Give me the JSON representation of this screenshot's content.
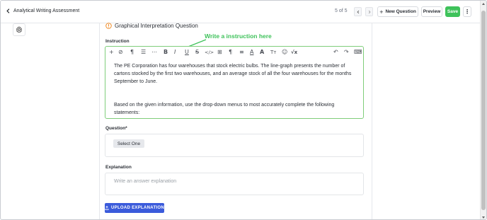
{
  "header": {
    "back_label": "Analytical Writing Assessment",
    "pager": "5 of 5",
    "new_question_label": "New Question",
    "preview_label": "Preview",
    "save_label": "Save"
  },
  "question": {
    "type_title": "Graphical Interpretation Question",
    "instruction_label": "Instruction",
    "annotation_text": "Write a instruction here",
    "instruction_paragraph_1": "The PE Corporation has four warehouses that stock electric bulbs. The line-graph presents the number of cartons stocked by the first two warehouses, and an average stock of all the four warehouses for the months September to June.",
    "instruction_paragraph_2": "Based on the given information, use the drop-down menus to most accurately complete the following statements:",
    "question_label": "Question*",
    "select_label": "Select One",
    "explanation_label": "Explanation",
    "explanation_placeholder": "Write an answer explanation",
    "upload_label": "UPLOAD EXPLANATION"
  },
  "toolbar": {
    "items": [
      "add-icon",
      "link-icon",
      "paragraph-icon",
      "list-icon",
      "more-icon",
      "bold-icon",
      "italic-icon",
      "underline-icon",
      "strikethrough-icon",
      "code-icon",
      "table-icon",
      "indent-icon",
      "align-icon",
      "font-color-icon",
      "font-size-icon",
      "text-height-icon",
      "emoji-icon",
      "formula-icon",
      "undo-icon",
      "redo-icon",
      "keyboard-icon"
    ],
    "glyphs": [
      "+",
      "⊘",
      "¶",
      "☰",
      "⋯",
      "B",
      "I",
      "U",
      "S",
      "</>",
      "⊞",
      "¶",
      "≡",
      "A",
      "A",
      "Tт",
      "☺",
      "√x",
      "↶",
      "↷",
      "⌨"
    ]
  },
  "colors": {
    "save_green": "#3ec25a",
    "annotation_green": "#3ec25a",
    "editor_border": "#7fce7a",
    "upload_blue": "#3b5bdb",
    "warning_orange": "#f08a24"
  }
}
